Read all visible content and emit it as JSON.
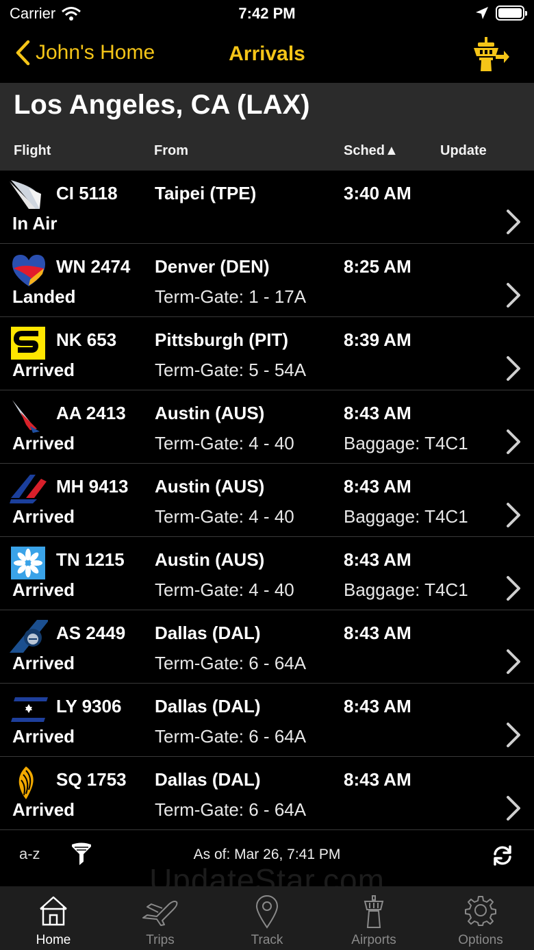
{
  "status_bar": {
    "carrier": "Carrier",
    "time": "7:42 PM"
  },
  "nav": {
    "back_label": "John's Home",
    "title": "Arrivals"
  },
  "airport": {
    "title": "Los Angeles, CA (LAX)"
  },
  "columns": {
    "flight": "Flight",
    "from": "From",
    "sched": "Sched▲",
    "update": "Update"
  },
  "flights": [
    {
      "logo": "china-airlines-logo",
      "flight": "CI 5118",
      "status": "In Air",
      "from": "Taipei (TPE)",
      "gate": "",
      "sched": "3:40 AM",
      "baggage": ""
    },
    {
      "logo": "southwest-logo",
      "flight": "WN 2474",
      "status": "Landed",
      "from": "Denver (DEN)",
      "gate": "Term-Gate: 1 - 17A",
      "sched": "8:25 AM",
      "baggage": ""
    },
    {
      "logo": "spirit-logo",
      "flight": "NK 653",
      "status": "Arrived",
      "from": "Pittsburgh (PIT)",
      "gate": "Term-Gate: 5 - 54A",
      "sched": "8:39 AM",
      "baggage": ""
    },
    {
      "logo": "american-airlines-logo",
      "flight": "AA 2413",
      "status": "Arrived",
      "from": "Austin (AUS)",
      "gate": "Term-Gate: 4 - 40",
      "sched": "8:43 AM",
      "baggage": "Baggage: T4C1"
    },
    {
      "logo": "malaysia-airlines-logo",
      "flight": "MH 9413",
      "status": "Arrived",
      "from": "Austin (AUS)",
      "gate": "Term-Gate: 4 - 40",
      "sched": "8:43 AM",
      "baggage": "Baggage: T4C1"
    },
    {
      "logo": "tunisair-logo",
      "flight": "TN 1215",
      "status": "Arrived",
      "from": "Austin (AUS)",
      "gate": "Term-Gate: 4 - 40",
      "sched": "8:43 AM",
      "baggage": "Baggage: T4C1"
    },
    {
      "logo": "alaska-airlines-logo",
      "flight": "AS 2449",
      "status": "Arrived",
      "from": "Dallas (DAL)",
      "gate": "Term-Gate: 6 - 64A",
      "sched": "8:43 AM",
      "baggage": ""
    },
    {
      "logo": "el-al-logo",
      "flight": "LY 9306",
      "status": "Arrived",
      "from": "Dallas (DAL)",
      "gate": "Term-Gate: 6 - 64A",
      "sched": "8:43 AM",
      "baggage": ""
    },
    {
      "logo": "singapore-airlines-logo",
      "flight": "SQ 1753",
      "status": "Arrived",
      "from": "Dallas (DAL)",
      "gate": "Term-Gate: 6 - 64A",
      "sched": "8:43 AM",
      "baggage": ""
    }
  ],
  "toolbar": {
    "sort_label": "a-z",
    "as_of": "As of: Mar 26, 7:41 PM"
  },
  "watermark": "UpdateStar.com",
  "tabs": [
    {
      "label": "Home",
      "icon": "home-icon",
      "active": true
    },
    {
      "label": "Trips",
      "icon": "plane-icon",
      "active": false
    },
    {
      "label": "Track",
      "icon": "map-pin-icon",
      "active": false
    },
    {
      "label": "Airports",
      "icon": "tower-icon",
      "active": false
    },
    {
      "label": "Options",
      "icon": "gear-icon",
      "active": false
    }
  ],
  "colors": {
    "accent": "#f5c518",
    "header_band": "#2b2b2b",
    "tab_bar": "#1e1e1e",
    "background": "#000000"
  }
}
